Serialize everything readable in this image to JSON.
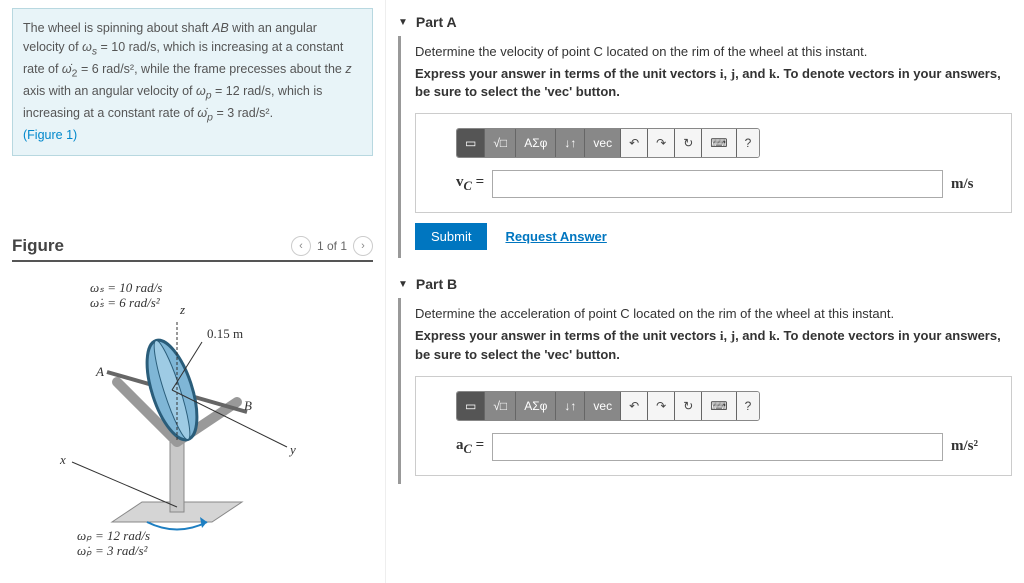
{
  "problem": {
    "text_parts": [
      "The wheel is spinning about shaft ",
      "AB",
      " with an angular velocity of ω",
      "s",
      " = 10 rad/s, which is increasing at a constant rate of ω̇",
      "2",
      " = 6 rad/s², while the frame precesses about the ",
      "z",
      " axis with an angular velocity of ω",
      "p",
      " = 12 rad/s, which is increasing at a constant rate of ω̇",
      "p",
      " = 3 rad/s²."
    ],
    "figref": "(Figure 1)"
  },
  "figure": {
    "title": "Figure",
    "counter": "1 of 1",
    "labels": {
      "ws": "ωₛ = 10 rad/s",
      "ws_dot": "ω̇ₛ = 6 rad/s²",
      "radius": "0.15 m",
      "A": "A",
      "B": "B",
      "z": "z",
      "x": "x",
      "y": "y",
      "wp": "ωₚ = 12 rad/s",
      "wp_dot": "ω̇ₚ = 3 rad/s²"
    }
  },
  "partA": {
    "header": "Part A",
    "prompt": "Determine the velocity of point C located on the rim of the wheel at this instant.",
    "instruction": "Express your answer in terms of the unit vectors i, j, and k. To denote vectors in your answers, be sure to select the 'vec' button.",
    "label_html": "v_C =",
    "unit": "m/s",
    "submit": "Submit",
    "request": "Request Answer"
  },
  "partB": {
    "header": "Part B",
    "prompt": "Determine the acceleration of point C located on the rim of the wheel at this instant.",
    "instruction": "Express your answer in terms of the unit vectors i, j, and k. To denote vectors in your answers, be sure to select the 'vec' button.",
    "label_html": "a_C =",
    "unit": "m/s²"
  },
  "toolbar": {
    "templates": "▭",
    "sqrt": "√□",
    "greek": "ΑΣφ",
    "arrows": "↓↑",
    "vec": "vec",
    "undo": "↶",
    "redo": "↷",
    "reset": "↻",
    "keyboard": "⌨",
    "help": "?"
  }
}
